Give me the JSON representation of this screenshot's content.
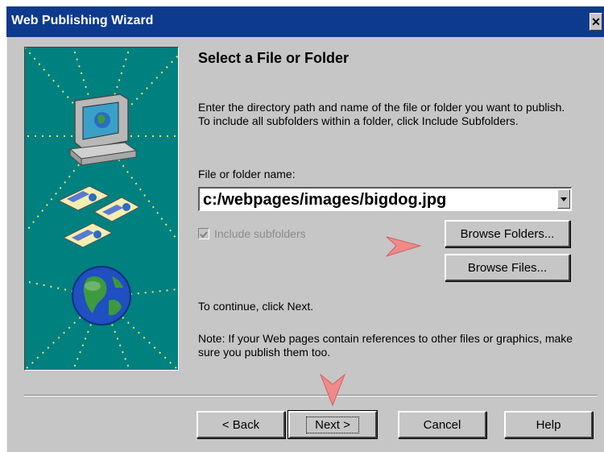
{
  "window": {
    "title": "Web Publishing Wizard",
    "close_glyph": "✕"
  },
  "page": {
    "heading": "Select a File or Folder",
    "instruction": "Enter the directory path and name of the file or folder you want to publish. To include all subfolders within a folder, click Include Subfolders.",
    "field_label": "File or folder name:",
    "field_value": "c:/webpages/images/bigdog.jpg",
    "include_subfolders_label": "Include subfolders",
    "include_subfolders_checked": true,
    "include_subfolders_enabled": false,
    "continue_text": "To continue, click Next.",
    "note_text": "Note: If your Web pages contain references to other files or graphics, make sure you publish them too."
  },
  "buttons": {
    "browse_folders": "Browse Folders...",
    "browse_files": "Browse Files...",
    "back": "< Back",
    "next": "Next >",
    "cancel": "Cancel",
    "help": "Help"
  },
  "icons": {
    "illustration": [
      "computer-icon",
      "web-page-icon",
      "globe-icon"
    ],
    "pointer_arrows": [
      "arrow-right-icon",
      "arrow-down-icon"
    ]
  },
  "colors": {
    "title_bar": "#0d3a8c",
    "dialog_face": "#c6c6c6",
    "illustration_bg": "#00807f",
    "pointer_arrow": "#f08a8a"
  }
}
